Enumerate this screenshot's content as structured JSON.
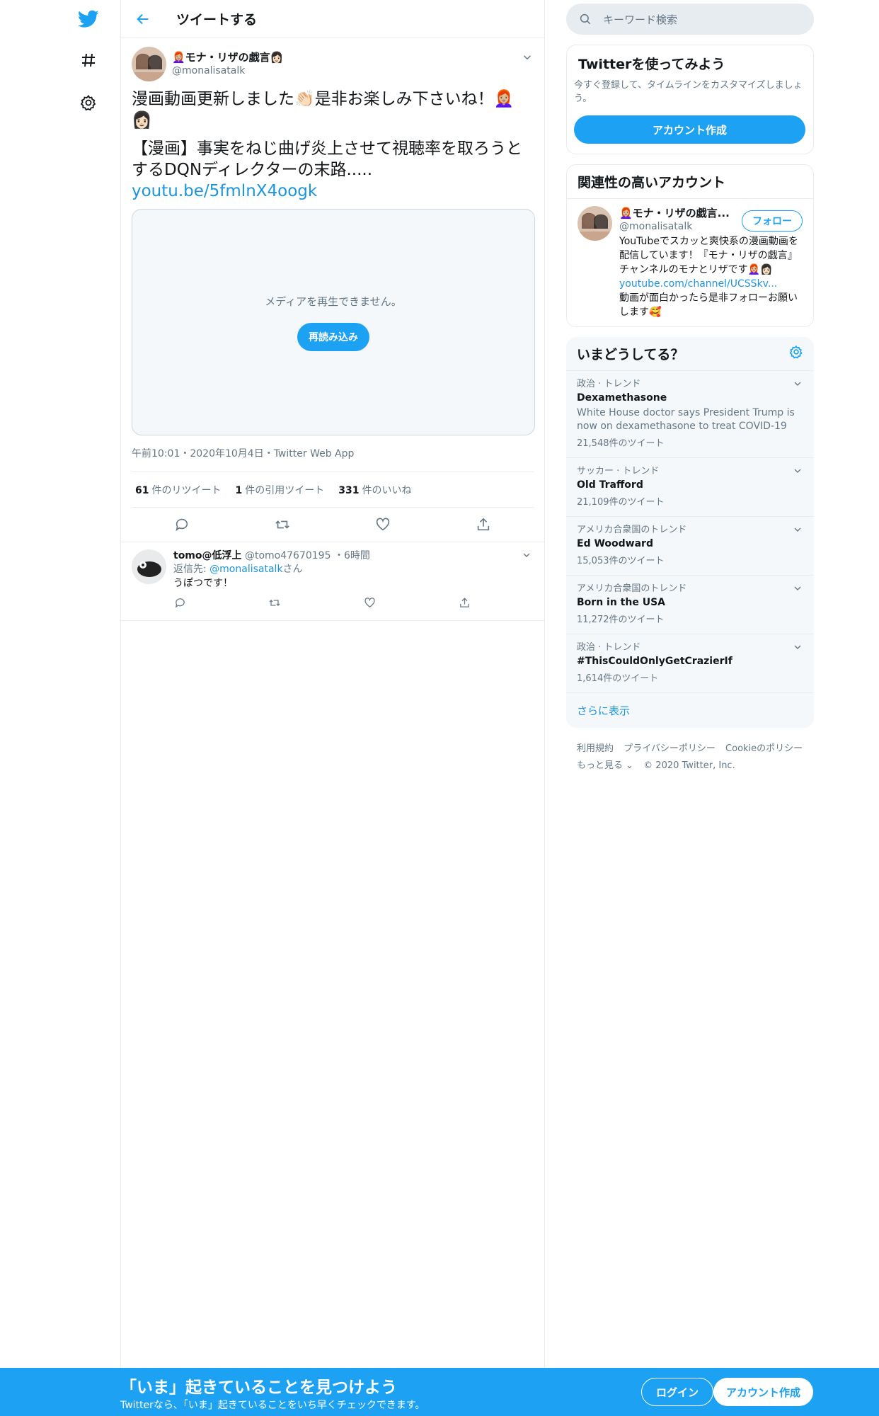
{
  "nav": {
    "icons": [
      "twitter-bird-icon",
      "hashtag-icon",
      "gear-icon"
    ]
  },
  "header": {
    "title": "ツイートする"
  },
  "tweet": {
    "author_name": "👩🏼‍🦰モナ・リザの戯言👩🏻",
    "author_handle": "@monalisatalk",
    "text_line1": "漫画動画更新しました👏🏻是非お楽しみ下さいね！👩🏼‍🦰👩🏻",
    "text_line2": "【漫画】事実をねじ曲げ炎上させて視聴率を取ろうとするDQNディレクターの末路.....",
    "link": "youtu.be/5fmlnX4oogk",
    "media_message": "メディアを再生できません。",
    "media_button": "再読み込み",
    "meta": "午前10:01・2020年10月4日・Twitter Web App",
    "retweets_count": "61",
    "retweets_label": "件のリツイート",
    "quotes_count": "1",
    "quotes_label": "件の引用ツイート",
    "likes_count": "331",
    "likes_label": "件のいいね"
  },
  "reply": {
    "name": "tomo@低浮上",
    "handle": "@tomo47670195",
    "time": "・6時間",
    "reply_to_prefix": "返信先: ",
    "reply_to_handle": "@monalisatalk",
    "reply_to_suffix": "さん",
    "text": "うぽつです！"
  },
  "sidebar": {
    "search_placeholder": "キーワード検索",
    "signup_title": "Twitterを使ってみよう",
    "signup_desc": "今すぐ登録して、タイムラインをカスタマイズしましょう。",
    "signup_button": "アカウント作成",
    "related_title": "関連性の高いアカウント",
    "account": {
      "name": "👩🏼‍🦰モナ・リザの戯言...",
      "handle": "@monalisatalk",
      "follow": "フォロー",
      "bio1": "YouTubeでスカッと爽快系の漫画動画を配信しています！『モナ・リザの戯言』チャンネルのモナとリザです👩🏼‍🦰👩🏻 ",
      "bio_link": "youtube.com/channel/UCSSkv...",
      "bio2": "動画が面白かったら是非フォローお願いします🥰"
    },
    "trends_title": "いまどうしてる？",
    "trends": [
      {
        "context": "政治 · トレンド",
        "name": "Dexamethasone",
        "desc": "White House doctor says President Trump is now on dexamethasone to treat COVID-19",
        "count": "21,548件のツイート"
      },
      {
        "context": "サッカー · トレンド",
        "name": "Old Trafford",
        "desc": "",
        "count": "21,109件のツイート"
      },
      {
        "context": "アメリカ合衆国のトレンド",
        "name": "Ed Woodward",
        "desc": "",
        "count": "15,053件のツイート"
      },
      {
        "context": "アメリカ合衆国のトレンド",
        "name": "Born in the USA",
        "desc": "",
        "count": "11,272件のツイート"
      },
      {
        "context": "政治 · トレンド",
        "name": "#ThisCouldOnlyGetCrazierIf",
        "desc": "",
        "count": "1,614件のツイート"
      }
    ],
    "show_more": "さらに表示",
    "footer": {
      "terms": "利用規約",
      "privacy": "プライバシーポリシー",
      "cookie": "Cookieのポリシー",
      "more": "もっと見る ⌄",
      "copyright": "© 2020 Twitter, Inc."
    }
  },
  "banner": {
    "title": "「いま」起きていることを見つけよう",
    "subtitle": "Twitterなら、「いま」起きていることをいち早くチェックできます。",
    "login": "ログイン",
    "signup": "アカウント作成"
  },
  "colors": {
    "accent": "#1da1f2",
    "link": "#1b95e0",
    "muted": "#657786",
    "border": "#e6ecf0"
  }
}
